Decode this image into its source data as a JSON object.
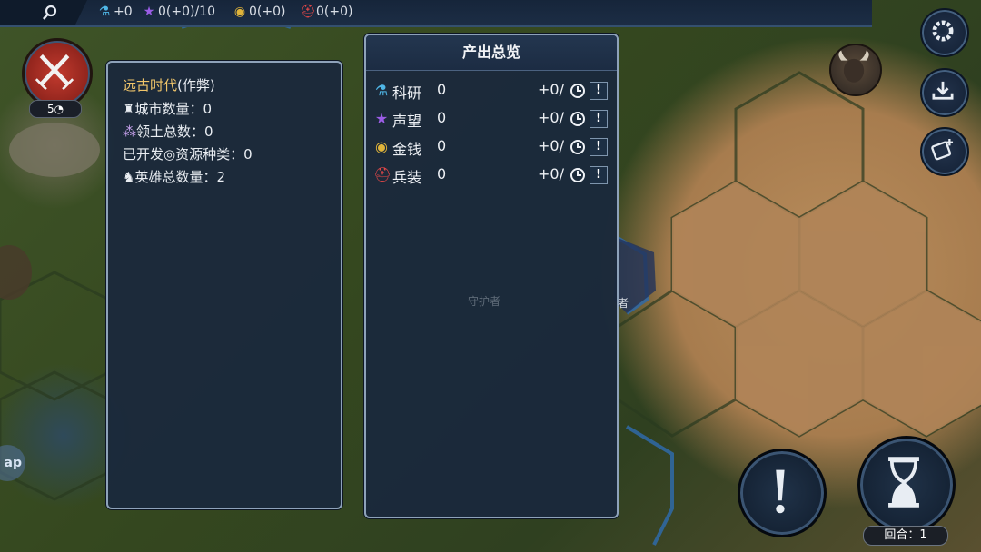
{
  "topbar": {
    "resources": [
      {
        "icon": "science-flask-icon",
        "color": "#4fb6e6",
        "text": "+0"
      },
      {
        "icon": "star-icon",
        "color": "#9b5de5",
        "text": "0(+0)/10"
      },
      {
        "icon": "gold-coin-icon",
        "color": "#e0b43a",
        "text": "0(+0)"
      },
      {
        "icon": "armor-helmet-icon",
        "color": "#e64848",
        "text": "0(+0)"
      }
    ]
  },
  "war": {
    "count": "5"
  },
  "left_panel": {
    "era": "远古时代",
    "era_suffix": "(作弊)",
    "rows": [
      {
        "icon": "castle-icon",
        "text": "城市数量：0"
      },
      {
        "icon": "territory-icon",
        "text": "领土总数：0"
      },
      {
        "icon": "resource-icon",
        "label_a": "已开发",
        "label_b": "资源种类：0"
      },
      {
        "icon": "hero-icon",
        "text": "英雄总数量：2"
      }
    ]
  },
  "output_panel": {
    "title": "产出总览",
    "rows": [
      {
        "icon": "science-flask-icon",
        "color": "#4fb6e6",
        "label": "科研",
        "value": "0",
        "rate": "+0/"
      },
      {
        "icon": "star-icon",
        "color": "#9b5de5",
        "label": "声望",
        "value": "0",
        "rate": "+0/"
      },
      {
        "icon": "gold-coin-icon",
        "color": "#e0b43a",
        "label": "金钱",
        "value": "0",
        "rate": "+0/"
      },
      {
        "icon": "armor-helmet-icon",
        "color": "#e64848",
        "label": "兵装",
        "value": "0",
        "rate": "+0/"
      }
    ],
    "info_glyph": "!"
  },
  "map_labels": {
    "app": "ap",
    "unit_a": "守护者",
    "unit_b": "者"
  },
  "turn": {
    "label": "回合：1"
  }
}
